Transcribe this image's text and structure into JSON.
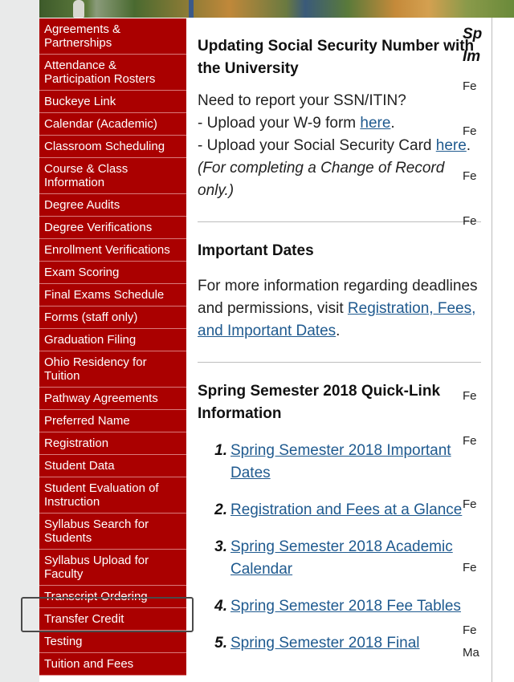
{
  "sidebar": {
    "items": [
      {
        "label": "Agreements & Partnerships"
      },
      {
        "label": "Attendance & Participation Rosters"
      },
      {
        "label": "Buckeye Link"
      },
      {
        "label": "Calendar (Academic)"
      },
      {
        "label": "Classroom Scheduling"
      },
      {
        "label": "Course & Class Information"
      },
      {
        "label": "Degree Audits"
      },
      {
        "label": "Degree Verifications"
      },
      {
        "label": "Enrollment Verifications"
      },
      {
        "label": "Exam Scoring"
      },
      {
        "label": "Final Exams Schedule"
      },
      {
        "label": "Forms (staff only)"
      },
      {
        "label": "Graduation Filing"
      },
      {
        "label": "Ohio Residency for Tuition"
      },
      {
        "label": "Pathway Agreements"
      },
      {
        "label": "Preferred Name"
      },
      {
        "label": "Registration"
      },
      {
        "label": "Student Data"
      },
      {
        "label": "Student Evaluation of Instruction"
      },
      {
        "label": "Syllabus Search for Students"
      },
      {
        "label": "Syllabus Upload for Faculty"
      },
      {
        "label": "Transcript Ordering"
      },
      {
        "label": "Transfer Credit"
      },
      {
        "label": "Testing"
      },
      {
        "label": "Tuition and Fees"
      }
    ],
    "highlighted": "Transfer Credit"
  },
  "ssn": {
    "title": "Updating Social Security Number with the University",
    "line1": "Need to report your SSN/ITIN?",
    "line2_prefix": "- Upload your W-9 form ",
    "line2_link": "here",
    "line2_suffix": ".",
    "line3_prefix": "- Upload your Social Security Card ",
    "line3_link": "here",
    "line3_suffix": ". ",
    "line3_note": "(For completing a Change of Record only.)"
  },
  "dates": {
    "title": "Important Dates",
    "text": "For more information regarding deadlines and permissions, visit ",
    "link": "Registration, Fees, and Important Dates",
    "suffix": "."
  },
  "quicklinks": {
    "title": "Spring Semester 2018 Quick-Link Information",
    "items": [
      {
        "num": "1.",
        "label": "Spring Semester 2018 Important Dates"
      },
      {
        "num": "2.",
        "label": "Registration and Fees at a Glance"
      },
      {
        "num": "3.",
        "label": "Spring Semester 2018 Academic Calendar"
      },
      {
        "num": "4.",
        "label": "Spring Semester 2018 Fee Tables"
      },
      {
        "num": "5.",
        "label": "Spring Semester 2018 Final"
      }
    ]
  },
  "right_column": {
    "heading_line1": "Sp",
    "heading_line2": "Im",
    "rows": [
      "Fe",
      "Fe",
      "Fe",
      "Fe",
      "Fe",
      "Fe",
      "Fe",
      "Fe",
      "Fe",
      "Ma"
    ]
  }
}
